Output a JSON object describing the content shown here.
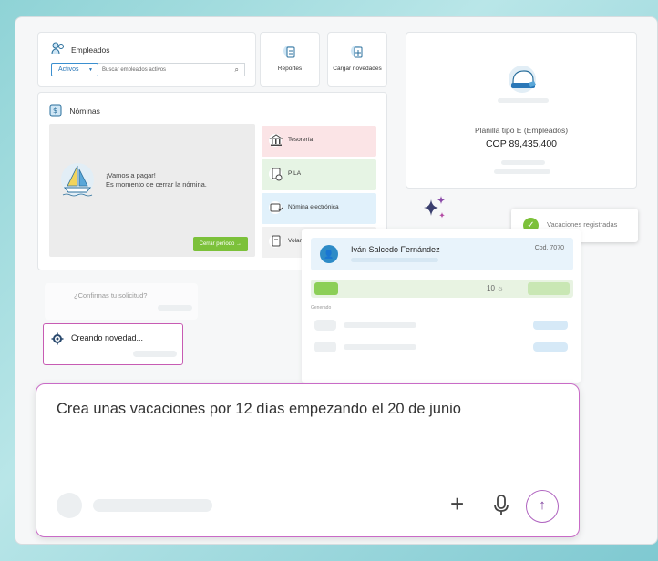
{
  "empleados": {
    "title": "Empleados",
    "filter": "Activos",
    "search_placeholder": "Buscar empleados activos"
  },
  "shortcuts": {
    "reportes": "Reportes",
    "cargar": "Cargar novedades"
  },
  "nominas": {
    "title": "Nóminas",
    "message_line1": "¡Vamos a pagar!",
    "message_line2": "Es momento de cerrar la nómina.",
    "close_button": "Cerrar periodo →",
    "options": [
      "Tesorería",
      "PILA",
      "Nómina electrónica",
      "Volan"
    ]
  },
  "planilla": {
    "subtitle": "Planilla tipo E (Empleados)",
    "amount": "COP 89,435,400"
  },
  "toast": {
    "text": "Vacaciones registradas"
  },
  "detail": {
    "name": "Iván Salcedo Fernández",
    "code": "Cod. 7070",
    "days": "10 ☼",
    "status_label": "Generado"
  },
  "assistant": {
    "confirm": "¿Confirmas tu solicitud?",
    "creating": "Creando novedad..."
  },
  "prompt": {
    "text": "Crea unas vacaciones por 12 días empezando el 20 de junio"
  },
  "colors": {
    "accent_green": "#7cc13a",
    "accent_blue": "#2d8bc7",
    "accent_magenta": "#c96bc7"
  }
}
